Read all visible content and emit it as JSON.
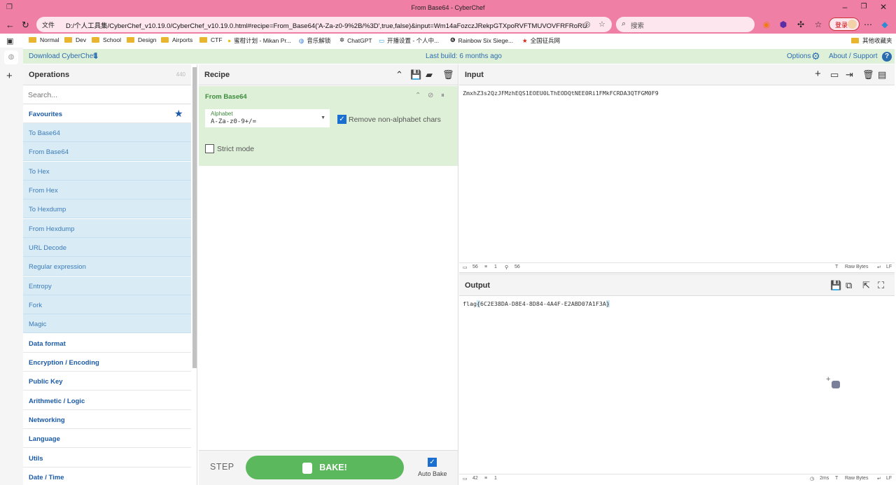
{
  "browser": {
    "window_title": "From Base64 - CyberChef",
    "url_prefix": "文件",
    "url": "D:/个人工具集/CyberChef_v10.19.0/CyberChef_v10.19.0.html#recipe=From_Base64('A-Za-z0-9%2B/%3D',true,false)&input=Wm14aFozczJRekpGTXpoRVFTMUVOVFRFRoRU9E...",
    "search_placeholder": "搜索",
    "login_label": "登录",
    "bookmarks": [
      "Normal",
      "Dev",
      "School",
      "Design",
      "Airports",
      "CTF",
      "蜜柑计划 - Mikan Pr...",
      "音乐解锁",
      "ChatGPT",
      "开播设置 - 个人中...",
      "Rainbow Six Siege...",
      "全国征兵网"
    ],
    "other_bookmarks": "其他收藏夹",
    "accent": "#f07fa5"
  },
  "banner": {
    "download_label": "Download CyberChef",
    "last_build": "Last build: 6 months ago",
    "options_label": "Options",
    "about_label": "About / Support"
  },
  "operations": {
    "title": "Operations",
    "count": "440",
    "search_placeholder": "Search...",
    "favourites_label": "Favourites",
    "favourites": [
      "To Base64",
      "From Base64",
      "To Hex",
      "From Hex",
      "To Hexdump",
      "From Hexdump",
      "URL Decode",
      "Regular expression",
      "Entropy",
      "Fork",
      "Magic"
    ],
    "categories": [
      "Data format",
      "Encryption / Encoding",
      "Public Key",
      "Arithmetic / Logic",
      "Networking",
      "Language",
      "Utils",
      "Date / Time"
    ]
  },
  "recipe": {
    "title": "Recipe",
    "operation": {
      "name": "From Base64",
      "alphabet_label": "Alphabet",
      "alphabet_value": "A-Za-z0-9+/=",
      "remove_non_alpha_label": "Remove non-alphabet chars",
      "remove_non_alpha_checked": true,
      "strict_mode_label": "Strict mode",
      "strict_mode_checked": false
    },
    "step_label": "STEP",
    "bake_label": "BAKE!",
    "auto_bake_label": "Auto Bake",
    "auto_bake_checked": true
  },
  "input": {
    "title": "Input",
    "text": "ZmxhZ3s2QzJFMzhEQS1EOEU0LThEODQtNEE0Ri1FMkFCRDA3QTFGM0F9",
    "length": "56",
    "lines": "1",
    "position": "56",
    "encoding": "Raw Bytes",
    "eol": "LF"
  },
  "output": {
    "title": "Output",
    "text_prefix": "flag",
    "text_open": "{",
    "text_body": "6C2E38DA-D8E4-8D84-4A4F-E2ABD07A1F3A",
    "text_close": "}",
    "length": "42",
    "lines": "1",
    "time": "2ms",
    "encoding": "Raw Bytes",
    "eol": "LF"
  }
}
